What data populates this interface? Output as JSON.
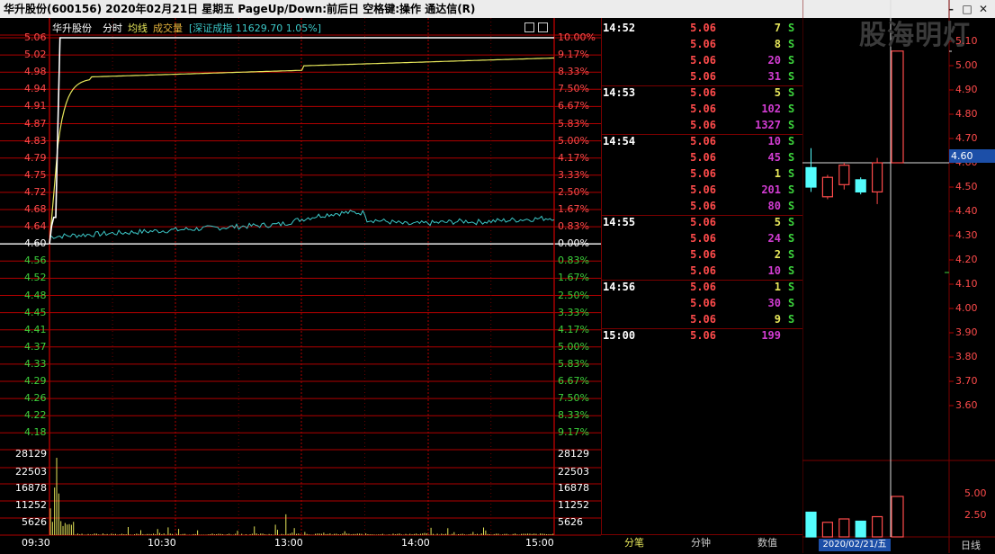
{
  "window": {
    "title": "华升股份(600156)  2020年02月21日  星期五  PageUp/Down:前后日  空格键:操作  通达信(R)"
  },
  "chart_header": {
    "stock": "华升股份",
    "mode": "分时",
    "avg_label": "均线",
    "vol_label": "成交量",
    "index_info": "[深证成指 11629.70 1.05%]"
  },
  "price_axis": {
    "up": [
      "5.06",
      "5.02",
      "4.98",
      "4.94",
      "4.91",
      "4.87",
      "4.83",
      "4.79",
      "4.75",
      "4.72",
      "4.68",
      "4.64"
    ],
    "base": "4.60",
    "down": [
      "4.56",
      "4.52",
      "4.48",
      "4.45",
      "4.41",
      "4.37",
      "4.33",
      "4.29",
      "4.26",
      "4.22",
      "4.18"
    ]
  },
  "pct_axis": {
    "up": [
      "10.00%",
      "9.17%",
      "8.33%",
      "7.50%",
      "6.67%",
      "5.83%",
      "5.00%",
      "4.17%",
      "3.33%",
      "2.50%",
      "1.67%",
      "0.83%"
    ],
    "base": "0.00%",
    "down": [
      "0.83%",
      "1.67%",
      "2.50%",
      "3.33%",
      "4.17%",
      "5.00%",
      "5.83%",
      "6.67%",
      "7.50%",
      "8.33%",
      "9.17%"
    ]
  },
  "volume_axis": [
    "28129",
    "22503",
    "16878",
    "11252",
    "5626"
  ],
  "time_axis": [
    "09:30",
    "10:30",
    "13:00",
    "14:00",
    "15:00"
  ],
  "ticks": [
    {
      "time": "14:52",
      "price": "5.06",
      "vol": "7",
      "flag": "S",
      "vc": "yel"
    },
    {
      "time": "",
      "price": "5.06",
      "vol": "8",
      "flag": "S",
      "vc": "yel"
    },
    {
      "time": "",
      "price": "5.06",
      "vol": "20",
      "flag": "S",
      "vc": "mag"
    },
    {
      "time": "",
      "price": "5.06",
      "vol": "31",
      "flag": "S",
      "vc": "mag"
    },
    {
      "time": "14:53",
      "price": "5.06",
      "vol": "5",
      "flag": "S",
      "vc": "yel"
    },
    {
      "time": "",
      "price": "5.06",
      "vol": "102",
      "flag": "S",
      "vc": "mag"
    },
    {
      "time": "",
      "price": "5.06",
      "vol": "1327",
      "flag": "S",
      "vc": "mag"
    },
    {
      "time": "14:54",
      "price": "5.06",
      "vol": "10",
      "flag": "S",
      "vc": "mag"
    },
    {
      "time": "",
      "price": "5.06",
      "vol": "45",
      "flag": "S",
      "vc": "mag"
    },
    {
      "time": "",
      "price": "5.06",
      "vol": "1",
      "flag": "S",
      "vc": "yel"
    },
    {
      "time": "",
      "price": "5.06",
      "vol": "201",
      "flag": "S",
      "vc": "mag"
    },
    {
      "time": "",
      "price": "5.06",
      "vol": "80",
      "flag": "S",
      "vc": "mag"
    },
    {
      "time": "14:55",
      "price": "5.06",
      "vol": "5",
      "flag": "S",
      "vc": "yel"
    },
    {
      "time": "",
      "price": "5.06",
      "vol": "24",
      "flag": "S",
      "vc": "mag"
    },
    {
      "time": "",
      "price": "5.06",
      "vol": "2",
      "flag": "S",
      "vc": "yel"
    },
    {
      "time": "",
      "price": "5.06",
      "vol": "10",
      "flag": "S",
      "vc": "mag"
    },
    {
      "time": "14:56",
      "price": "5.06",
      "vol": "1",
      "flag": "S",
      "vc": "yel"
    },
    {
      "time": "",
      "price": "5.06",
      "vol": "30",
      "flag": "S",
      "vc": "mag"
    },
    {
      "time": "",
      "price": "5.06",
      "vol": "9",
      "flag": "S",
      "vc": "yel"
    },
    {
      "time": "15:00",
      "price": "5.06",
      "vol": "199",
      "flag": "",
      "vc": "mag"
    }
  ],
  "tick_tabs": [
    "分笔",
    "分钟",
    "数值"
  ],
  "kline": {
    "watermark": "股海明灯",
    "axis": [
      "5.10",
      "5.00",
      "4.90",
      "4.80",
      "4.70",
      "4.60",
      "4.50",
      "4.40",
      "4.30",
      "4.20",
      "4.10",
      "4.00",
      "3.90",
      "3.80",
      "3.70",
      "3.60"
    ],
    "current_price": "4.60",
    "vol_axis": [
      "5.00",
      "2.50"
    ],
    "date_label": "2020/02/21/五",
    "period_label": "日线",
    "candles": [
      {
        "open": 4.58,
        "close": 4.5,
        "high": 4.66,
        "low": 4.48
      },
      {
        "open": 4.46,
        "close": 4.54,
        "high": 4.55,
        "low": 4.45
      },
      {
        "open": 4.51,
        "close": 4.59,
        "high": 4.6,
        "low": 4.49
      },
      {
        "open": 4.53,
        "close": 4.48,
        "high": 4.54,
        "low": 4.47
      },
      {
        "open": 4.48,
        "close": 4.6,
        "high": 4.62,
        "low": 4.43
      },
      {
        "open": 4.6,
        "close": 5.06,
        "high": 5.06,
        "low": 4.6
      }
    ],
    "volumes": [
      2.2,
      1.3,
      1.6,
      1.4,
      1.8,
      3.6
    ],
    "vol_colors": [
      "cyan",
      "red",
      "red",
      "cyan",
      "red",
      "red"
    ]
  },
  "chart_data": {
    "type": "line",
    "title": "华升股份 分时",
    "x": [
      "09:30",
      "10:30",
      "13:00",
      "14:00",
      "15:00"
    ],
    "series": [
      {
        "name": "价格",
        "values": [
          4.6,
          5.06,
          5.06,
          5.06,
          5.06
        ]
      },
      {
        "name": "均线",
        "values": [
          4.6,
          4.99,
          5.03,
          5.04,
          5.05
        ]
      },
      {
        "name": "深证成指",
        "values": [
          4.62,
          4.65,
          4.68,
          4.66,
          4.65
        ]
      }
    ],
    "ylim": [
      4.18,
      5.06
    ],
    "volume_ylim": [
      0,
      28129
    ]
  }
}
